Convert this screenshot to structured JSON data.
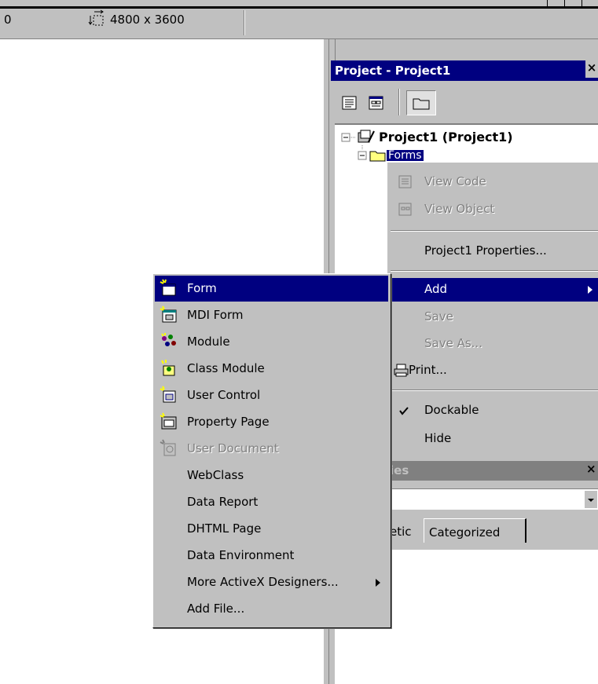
{
  "toolbar": {
    "position_readout": "0",
    "size_readout": "4800 x 3600"
  },
  "project_window": {
    "title": "Project - Project1",
    "close_glyph": "×",
    "tree": {
      "root_label": "Project1 (Project1)",
      "folder_label": "Forms"
    }
  },
  "context_menu": {
    "view_code": "View Code",
    "view_object": "View Object",
    "properties": "Project1 Properties...",
    "add": "Add",
    "save": "Save",
    "save_as": "Save As...",
    "print": "Print...",
    "dockable": "Dockable",
    "hide": "Hide",
    "dockable_checked": true
  },
  "properties_window": {
    "title_fragment": "ies",
    "tab_alpha_fragment": "etic",
    "tab_categorized": "Categorized"
  },
  "add_submenu": {
    "items": [
      {
        "label": "Form",
        "icon": "form-icon"
      },
      {
        "label": "MDI Form",
        "icon": "mdi-form-icon"
      },
      {
        "label": "Module",
        "icon": "module-icon"
      },
      {
        "label": "Class Module",
        "icon": "class-module-icon"
      },
      {
        "label": "User Control",
        "icon": "user-control-icon"
      },
      {
        "label": "Property Page",
        "icon": "property-page-icon"
      },
      {
        "label": "User Document",
        "icon": "user-document-icon"
      },
      {
        "label": "WebClass"
      },
      {
        "label": "Data Report"
      },
      {
        "label": "DHTML Page"
      },
      {
        "label": "Data Environment"
      },
      {
        "label": "More ActiveX Designers..."
      },
      {
        "label": "Add File..."
      }
    ]
  },
  "colors": {
    "highlight": "#000080",
    "face": "#c0c0c0",
    "shadow": "#808080"
  }
}
